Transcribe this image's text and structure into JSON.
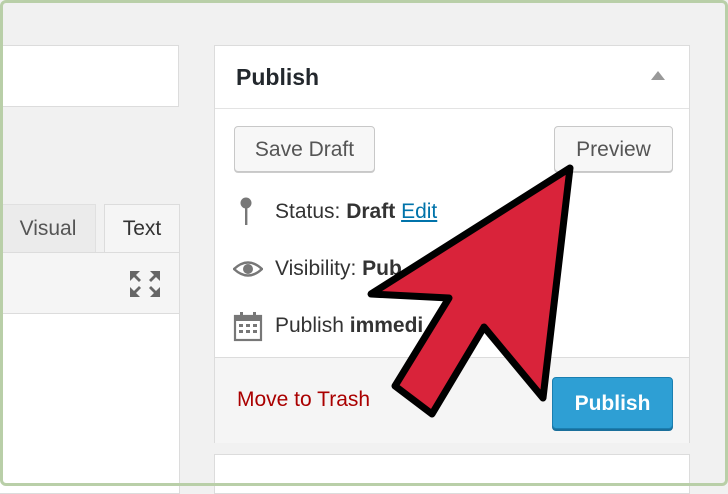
{
  "editor": {
    "tabs": [
      {
        "label": "Visual"
      },
      {
        "label": "Text"
      }
    ],
    "fullscreen_icon": "fullscreen-expand-icon"
  },
  "publish": {
    "title": "Publish",
    "collapse_icon": "triangle-up-icon",
    "save_draft_label": "Save Draft",
    "preview_label": "Preview",
    "status": {
      "icon": "pin-icon",
      "label": "Status:",
      "value": "Draft",
      "edit_link": "Edit"
    },
    "visibility": {
      "icon": "eye-icon",
      "label": "Visibility:",
      "value": "Pub"
    },
    "schedule": {
      "icon": "calendar-icon",
      "label": "Publish",
      "value": "immedi"
    },
    "trash_label": "Move to Trash",
    "publish_label": "Publish"
  },
  "overlay": {
    "icon": "red-pointer-arrow-icon",
    "color": "#d9233a"
  },
  "colors": {
    "primary_button": "#2e9fd4",
    "link": "#0073aa",
    "trash": "#aa0000"
  }
}
